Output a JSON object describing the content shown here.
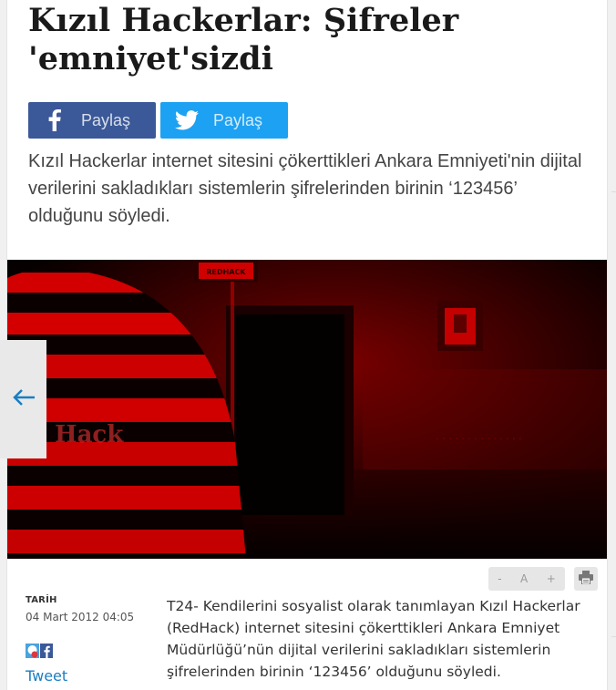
{
  "article": {
    "headline": "Kızıl Hackerlar: Şifreler 'emniyet'sizdi",
    "summary": "Kızıl Hackerlar internet sitesini çökerttikleri Ankara Emniyeti'nin dijital verilerini sakladıkları sistemlerin şifrelerinden birinin ‘123456’ olduğunu söyledi.",
    "body": "T24- Kendilerini sosyalist olarak tanımlayan Kızıl Hackerlar (RedHack) internet sitesini çökerttikleri  Ankara Emniyet Müdürlüğü’nün dijital verilerini sakladıkları sistemlerin şifrelerinden birinin ‘123456’ olduğunu söyledi."
  },
  "share": {
    "facebook_label": "Paylaş",
    "twitter_label": "Paylaş",
    "tweet_link": "Tweet"
  },
  "meta": {
    "date_label": "TARİH",
    "date_value": "04 Mart 2012 04:05"
  },
  "hero_image": {
    "sign_text": "REDHACK",
    "wall_text": "Hack"
  },
  "tools": {
    "font_decrease": "-",
    "font_reset": "A",
    "font_increase": "+"
  },
  "icons": {
    "facebook": "facebook-f-icon",
    "twitter": "twitter-bird-icon",
    "print": "printer-icon",
    "prev": "arrow-left-icon"
  },
  "colors": {
    "facebook": "#3b5998",
    "twitter": "#1da1f2",
    "link": "#1b7ec2"
  }
}
